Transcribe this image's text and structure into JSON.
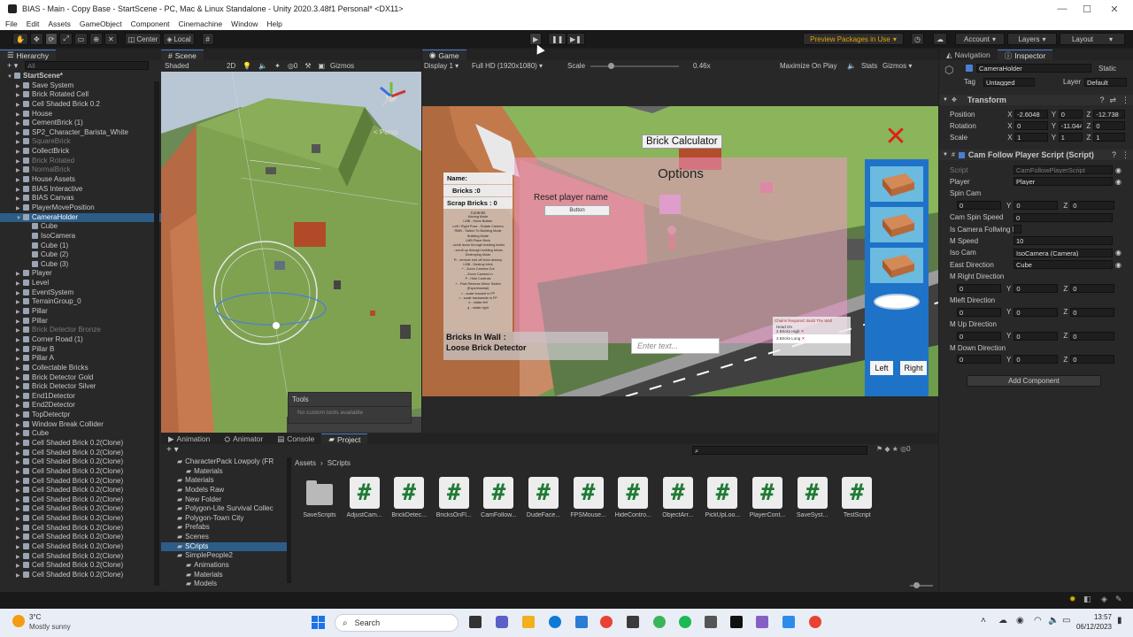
{
  "window": {
    "title": "BIAS - Main - Copy Base - StartScene - PC, Mac & Linux Standalone - Unity 2020.3.48f1 Personal* <DX11>",
    "minimize": "—",
    "maximize": "☐",
    "close": "✕"
  },
  "menu": [
    "File",
    "Edit",
    "Assets",
    "GameObject",
    "Component",
    "Cinemachine",
    "Window",
    "Help"
  ],
  "toolbar": {
    "pivot": "Center",
    "space": "Local",
    "preview": "Preview Packages in Use",
    "account": "Account",
    "layers": "Layers",
    "layout": "Layout"
  },
  "hierarchy": {
    "tab": "Hierarchy",
    "search_placeholder": "All",
    "items": [
      {
        "label": "StartScene*",
        "depth": 0,
        "kind": "scene"
      },
      {
        "label": "Save System",
        "depth": 1
      },
      {
        "label": "Brick Rotated Cell",
        "depth": 1
      },
      {
        "label": "Cell Shaded Brick 0.2",
        "depth": 1
      },
      {
        "label": "House",
        "depth": 1
      },
      {
        "label": "CementBrick (1)",
        "depth": 1
      },
      {
        "label": "SP2_Character_Barista_White",
        "depth": 1
      },
      {
        "label": "SquareBrick",
        "depth": 1,
        "dim": true
      },
      {
        "label": "CollectBrick",
        "depth": 1
      },
      {
        "label": "Brick Rotated",
        "depth": 1,
        "dim": true
      },
      {
        "label": "NormalBrick",
        "depth": 1,
        "dim": true
      },
      {
        "label": "House Assets",
        "depth": 1
      },
      {
        "label": "BIAS Interactive",
        "depth": 1
      },
      {
        "label": "BIAS Canvas",
        "depth": 1
      },
      {
        "label": "PlayerMovePosition",
        "depth": 1
      },
      {
        "label": "CameraHolder",
        "depth": 1,
        "selected": true
      },
      {
        "label": "Cube",
        "depth": 2
      },
      {
        "label": "IsoCamera",
        "depth": 2
      },
      {
        "label": "Cube (1)",
        "depth": 2
      },
      {
        "label": "Cube (2)",
        "depth": 2
      },
      {
        "label": "Cube (3)",
        "depth": 2
      },
      {
        "label": "Player",
        "depth": 1
      },
      {
        "label": "Level",
        "depth": 1
      },
      {
        "label": "EventSystem",
        "depth": 1
      },
      {
        "label": "TerrainGroup_0",
        "depth": 1
      },
      {
        "label": "Pillar",
        "depth": 1
      },
      {
        "label": "Pillar",
        "depth": 1
      },
      {
        "label": "Brick Detector Bronze",
        "depth": 1,
        "dim": true
      },
      {
        "label": "Corner Road (1)",
        "depth": 1
      },
      {
        "label": "Pillar B",
        "depth": 1
      },
      {
        "label": "Pillar A",
        "depth": 1
      },
      {
        "label": "Collectable Bricks",
        "depth": 1
      },
      {
        "label": "Brick Detector Gold",
        "depth": 1
      },
      {
        "label": "Brick Detector Silver",
        "depth": 1
      },
      {
        "label": "End1Detector",
        "depth": 1
      },
      {
        "label": "End2Detector",
        "depth": 1
      },
      {
        "label": "TopDetectpr",
        "depth": 1
      },
      {
        "label": "Window Break Collider",
        "depth": 1
      },
      {
        "label": "Cube",
        "depth": 1
      },
      {
        "label": "Cell Shaded Brick 0.2(Clone)",
        "depth": 1
      },
      {
        "label": "Cell Shaded Brick 0.2(Clone)",
        "depth": 1
      },
      {
        "label": "Cell Shaded Brick 0.2(Clone)",
        "depth": 1
      },
      {
        "label": "Cell Shaded Brick 0.2(Clone)",
        "depth": 1
      },
      {
        "label": "Cell Shaded Brick 0.2(Clone)",
        "depth": 1
      },
      {
        "label": "Cell Shaded Brick 0.2(Clone)",
        "depth": 1
      },
      {
        "label": "Cell Shaded Brick 0.2(Clone)",
        "depth": 1
      },
      {
        "label": "Cell Shaded Brick 0.2(Clone)",
        "depth": 1
      },
      {
        "label": "Cell Shaded Brick 0.2(Clone)",
        "depth": 1
      },
      {
        "label": "Cell Shaded Brick 0.2(Clone)",
        "depth": 1
      },
      {
        "label": "Cell Shaded Brick 0.2(Clone)",
        "depth": 1
      },
      {
        "label": "Cell Shaded Brick 0.2(Clone)",
        "depth": 1
      },
      {
        "label": "Cell Shaded Brick 0.2(Clone)",
        "depth": 1
      },
      {
        "label": "Cell Shaded Brick 0.2(Clone)",
        "depth": 1
      },
      {
        "label": "Cell Shaded Brick 0.2(Clone)",
        "depth": 1
      }
    ]
  },
  "scene": {
    "tab": "Scene",
    "shading": "Shaded",
    "mode2d": "2D",
    "gizmos": "Gizmos",
    "persp": "< Persp",
    "tools_title": "Tools",
    "tools_msg": "No custom tools available"
  },
  "game": {
    "tab": "Game",
    "display": "Display 1",
    "resolution": "Full HD (1920x1080)",
    "scale_label": "Scale",
    "scale_value": "0.46x",
    "maximize": "Maximize On Play",
    "stats": "Stats",
    "gizmos": "Gizmos",
    "brick_calculator": "Brick Calculator",
    "options_title": "Options",
    "reset_label": "Reset player name",
    "button_label": "Button",
    "name_label": "Name:",
    "bricks_label": "Bricks :0",
    "scrap_label": "Scrap Bricks : 0",
    "controls_title": "Controls",
    "controls_lines": [
      "Moving Mode",
      "LMB - Move Builder",
      "Left / Right Pose - Rotate Camera",
      "RMB - Switch To Building Mode",
      "Building Mode",
      "LMB Place Brick",
      "- scroll down through building bricks",
      "- scroll up through building bricks",
      "Destroying Mode",
      "R - remove end off brick destroy",
      "LMB - Destroy brick",
      "+ - Zoom Camera Out",
      "- - Zoom Camera In",
      "P - Hide Controls",
      "+ - Past Reverse Mirror Switch",
      "(Experimental)",
      "= - scale forward in FP",
      "= - scale backwards in FP",
      "e - rotate left",
      "q - rotate right"
    ],
    "bricks_in_wall": "Bricks In Wall :",
    "loose_detector": "Loose Brick Detector",
    "enter_placeholder": "Enter text...",
    "left": "Left",
    "right": "Right",
    "chains_title": "Chains Required: Build The Wall",
    "chain1": "Head On",
    "chain2": "2 Bricks High",
    "chain3": "3 Bricks Long"
  },
  "inspector": {
    "tabs": [
      "Navigation",
      "Inspector"
    ],
    "object_name": "CameraHolder",
    "static": "Static",
    "tag_label": "Tag",
    "tag_value": "Untagged",
    "layer_label": "Layer",
    "layer_value": "Default",
    "transform_title": "Transform",
    "position_label": "Position",
    "pos_x": "-2.6048",
    "pos_y": "0",
    "pos_z": "-12.738",
    "rotation_label": "Rotation",
    "rot_x": "0",
    "rot_y": "-11.044",
    "rot_z": "0",
    "scale_label": "Scale",
    "scl_x": "1",
    "scl_y": "1",
    "scl_z": "1",
    "script_title": "Cam Follow Player Script (Script)",
    "fields": [
      {
        "label": "Script",
        "value": "CamFollowPlayerScript",
        "kind": "obj",
        "dim": true
      },
      {
        "label": "Player",
        "value": "Player",
        "kind": "obj"
      },
      {
        "label": "Spin Cam",
        "kind": "header"
      },
      {
        "label": "X",
        "value": "0",
        "kind": "xyz",
        "y": "0",
        "z": "0"
      },
      {
        "label": "Cam Spin Speed",
        "value": "0",
        "kind": "val"
      },
      {
        "label": "Is Camera Follwing M",
        "value": "",
        "kind": "check"
      },
      {
        "label": "M Speed",
        "value": "10",
        "kind": "val"
      },
      {
        "label": "Iso Cam",
        "value": "IsoCamera (Camera)",
        "kind": "obj"
      },
      {
        "label": "East Direction",
        "value": "Cube",
        "kind": "obj"
      },
      {
        "label": "M Right Direction",
        "kind": "header"
      },
      {
        "label": "X",
        "value": "0",
        "kind": "xyz",
        "y": "0",
        "z": "0"
      },
      {
        "label": "Mleft Direction",
        "kind": "header"
      },
      {
        "label": "X",
        "value": "0",
        "kind": "xyz",
        "y": "0",
        "z": "0"
      },
      {
        "label": "M Up Direction",
        "kind": "header"
      },
      {
        "label": "X",
        "value": "0",
        "kind": "xyz",
        "y": "0",
        "z": "0"
      },
      {
        "label": "M Down Direction",
        "kind": "header"
      },
      {
        "label": "X",
        "value": "0",
        "kind": "xyz",
        "y": "0",
        "z": "0"
      }
    ],
    "add_component": "Add Component"
  },
  "bottom": {
    "tabs": [
      "Animation",
      "Animator",
      "Console",
      "Project"
    ],
    "breadcrumb_root": "Assets",
    "breadcrumb_sep": "›",
    "breadcrumb_leaf": "SCripts",
    "tree": [
      {
        "label": "CharacterPack Lowpoly (FR",
        "depth": 1
      },
      {
        "label": "Materials",
        "depth": 2
      },
      {
        "label": "Materials",
        "depth": 1
      },
      {
        "label": "Models Raw",
        "depth": 1
      },
      {
        "label": "New Folder",
        "depth": 1
      },
      {
        "label": "Polygon-Lite Survival Collec",
        "depth": 1
      },
      {
        "label": "Polygon-Town City",
        "depth": 1
      },
      {
        "label": "Prefabs",
        "depth": 1
      },
      {
        "label": "Scenes",
        "depth": 1
      },
      {
        "label": "SCripts",
        "depth": 1,
        "selected": true
      },
      {
        "label": "SimplePeople2",
        "depth": 1
      },
      {
        "label": "Animations",
        "depth": 2
      },
      {
        "label": "Materials",
        "depth": 2
      },
      {
        "label": "Models",
        "depth": 2
      }
    ],
    "assets": [
      "SaveScripts",
      "AdjustCam...",
      "BrickDetec...",
      "BricksOnFl...",
      "CamFollow...",
      "DudeFace...",
      "FPSMouse...",
      "HideContro...",
      "ObjectArr...",
      "PickUpLoo...",
      "PlayerCont...",
      "SaveSyst...",
      "TestScript"
    ]
  },
  "taskbar": {
    "temp": "3°C",
    "weather": "Mostly sunny",
    "search": "Search",
    "time": "13:57",
    "date": "06/12/2023"
  },
  "colors": {
    "accent": "#4a7fd8",
    "selected": "#2c5d87",
    "script_green": "#1f7a34"
  }
}
